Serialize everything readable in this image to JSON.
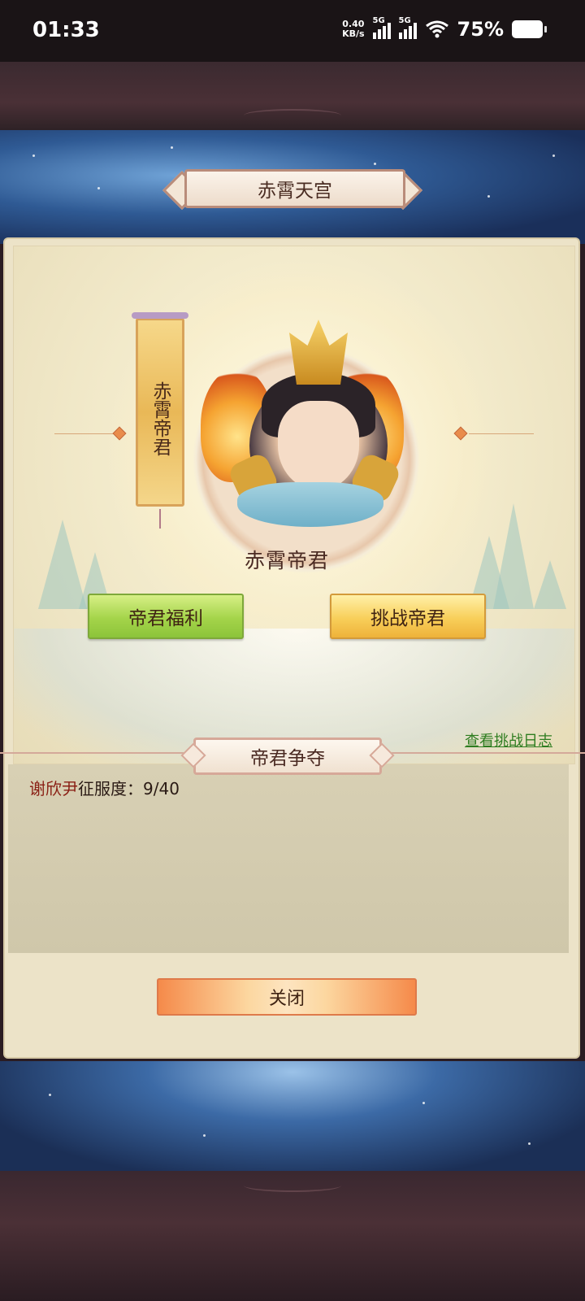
{
  "status_bar": {
    "time": "01:33",
    "net_speed_value": "0.40",
    "net_speed_unit": "KB/s",
    "signal1_label": "5G",
    "signal2_label": "5G",
    "battery_percent": "75%",
    "icons": [
      "signal-icon",
      "signal-icon",
      "wifi-icon",
      "battery-icon"
    ]
  },
  "header": {
    "title": "赤霄天宫"
  },
  "hero": {
    "banner_text": "赤霄帝君",
    "name": "赤霄帝君"
  },
  "actions": {
    "welfare_label": "帝君福利",
    "challenge_label": "挑战帝君"
  },
  "log_link": "查看挑战日志",
  "section": {
    "title": "帝君争夺",
    "conqueror_name": "谢欣尹",
    "conquest_label": "征服度：",
    "conquest_value": "9/40"
  },
  "footer": {
    "close_label": "关闭"
  },
  "colors": {
    "green_button": "#a4d44a",
    "gold_button": "#f8cf5a",
    "close_button": "#f58a4a",
    "link": "#2e7d20",
    "name_highlight": "#8a1f14"
  }
}
